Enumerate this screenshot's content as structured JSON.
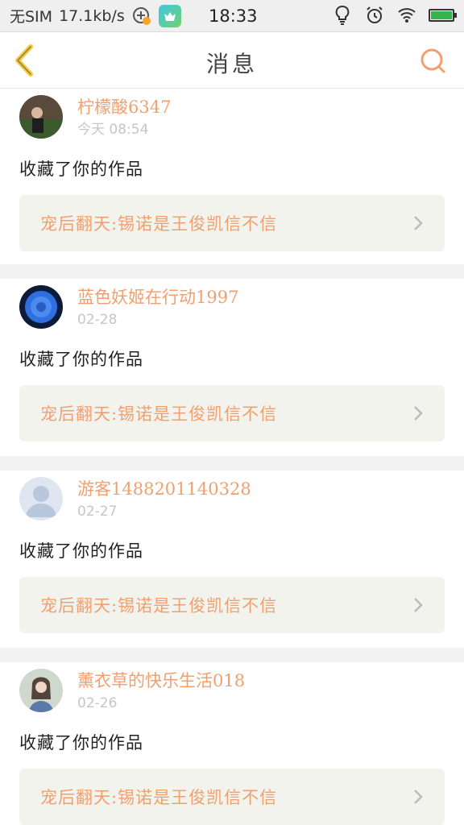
{
  "status_bar": {
    "carrier": "无SIM",
    "speed": "17.1kb/s",
    "time": "18:33",
    "icons": [
      "add-circle-icon",
      "app-store-icon",
      "bulb-icon",
      "alarm-icon",
      "wifi-icon",
      "battery-icon"
    ]
  },
  "header": {
    "title": "消息",
    "back_icon": "chevron-left-icon",
    "search_icon": "search-icon"
  },
  "colors": {
    "accent": "#f0a070",
    "back_icon": "#f5c842",
    "card_bg": "#f3f3ee",
    "timestamp": "#c6c6c6"
  },
  "messages": [
    {
      "username": "柠檬酸6347",
      "time": "今天 08:54",
      "action": "收藏了你的作品",
      "work_title": "宠后翻天:锡诺是王俊凯信不信"
    },
    {
      "username": "蓝色妖姬在行动1997",
      "time": "02-28",
      "action": "收藏了你的作品",
      "work_title": "宠后翻天:锡诺是王俊凯信不信"
    },
    {
      "username": "游客1488201140328",
      "time": "02-27",
      "action": "收藏了你的作品",
      "work_title": "宠后翻天:锡诺是王俊凯信不信"
    },
    {
      "username": "薰衣草的快乐生活018",
      "time": "02-26",
      "action": "收藏了你的作品",
      "work_title": "宠后翻天:锡诺是王俊凯信不信"
    }
  ]
}
